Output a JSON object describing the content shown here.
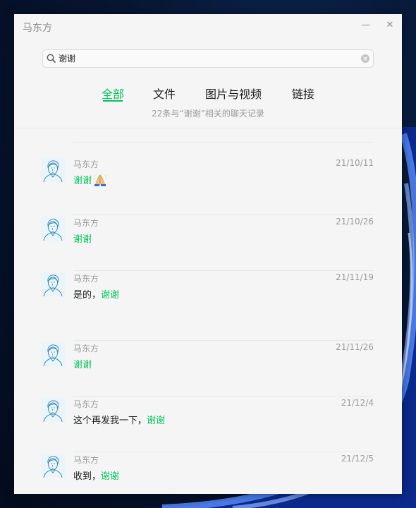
{
  "window": {
    "title": "马东方",
    "minimize_glyph": "—",
    "close_glyph": "✕"
  },
  "search": {
    "value": "谢谢",
    "icon": "search-icon",
    "clear_icon": "clear-icon"
  },
  "tabs": [
    {
      "label": "全部",
      "active": true
    },
    {
      "label": "文件",
      "active": false
    },
    {
      "label": "图片与视频",
      "active": false
    },
    {
      "label": "链接",
      "active": false
    }
  ],
  "result_summary": "22条与“谢谢”相关的聊天记录",
  "messages": [
    {
      "sender": "马东方",
      "date": "21/10/11",
      "prefix": "",
      "highlight": "谢谢",
      "emoji": "folded-hands"
    },
    {
      "sender": "马东方",
      "date": "21/10/26",
      "prefix": "",
      "highlight": "谢谢"
    },
    {
      "sender": "马东方",
      "date": "21/11/19",
      "prefix": "是的，",
      "highlight": "谢谢"
    },
    {
      "sender": "马东方",
      "date": "21/11/26",
      "prefix": "",
      "highlight": "谢谢"
    },
    {
      "sender": "马东方",
      "date": "21/12/4",
      "prefix": "这个再发我一下，",
      "highlight": "谢谢"
    },
    {
      "sender": "马东方",
      "date": "21/12/5",
      "prefix": "收到，",
      "highlight": "谢谢"
    }
  ],
  "colors": {
    "accent": "#07c160",
    "window_bg": "#f5f5f5",
    "muted_text": "#9b9b9b"
  }
}
